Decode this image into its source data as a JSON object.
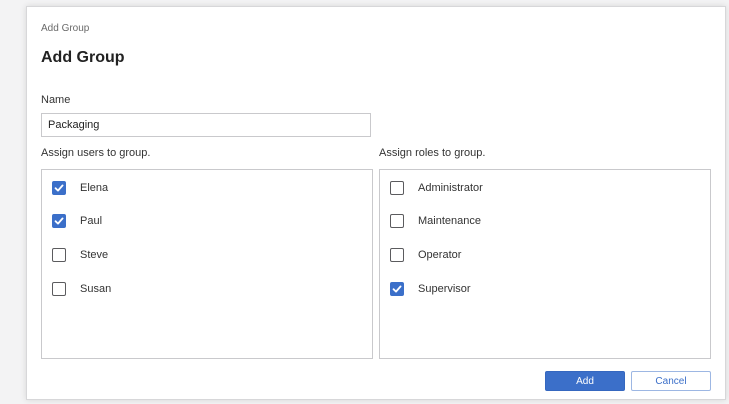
{
  "dialog": {
    "breadcrumb": "Add Group",
    "title": "Add Group",
    "name_label": "Name",
    "name_value": "Packaging",
    "users_label": "Assign users to group.",
    "roles_label": "Assign roles to group."
  },
  "users": [
    {
      "label": "Elena",
      "checked": true
    },
    {
      "label": "Paul",
      "checked": true
    },
    {
      "label": "Steve",
      "checked": false
    },
    {
      "label": "Susan",
      "checked": false
    }
  ],
  "roles": [
    {
      "label": "Administrator",
      "checked": false
    },
    {
      "label": "Maintenance",
      "checked": false
    },
    {
      "label": "Operator",
      "checked": false
    },
    {
      "label": "Supervisor",
      "checked": true
    }
  ],
  "buttons": {
    "add_label": "Add",
    "cancel_label": "Cancel"
  },
  "colors": {
    "accent": "#3b6fc9",
    "border": "#c9c9cc"
  },
  "icons": {
    "checkbox_checked": "check-icon"
  }
}
